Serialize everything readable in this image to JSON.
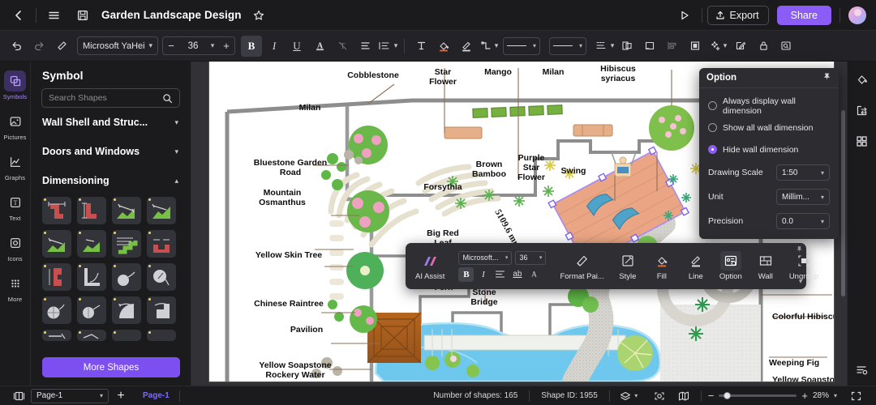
{
  "topbar": {
    "doc_title": "Garden Landscape Design",
    "export_label": "Export",
    "share_label": "Share",
    "icons": [
      "back-icon",
      "menu-icon",
      "save-icon",
      "star-icon",
      "present-icon",
      "upload-icon",
      "avatar"
    ]
  },
  "format_toolbar": {
    "font_family": "Microsoft YaHei",
    "font_size": "36",
    "decrease": "−",
    "increase": "+",
    "bold": "B",
    "italic": "I",
    "underline": "U",
    "font_color": "A",
    "strikethrough": "T"
  },
  "rail": {
    "items": [
      {
        "label": "Symbols",
        "icon": "symbols-icon",
        "selected": true
      },
      {
        "label": "Pictures",
        "icon": "pictures-icon",
        "selected": false
      },
      {
        "label": "Graphs",
        "icon": "graphs-icon",
        "selected": false
      },
      {
        "label": "Text",
        "icon": "text-icon",
        "selected": false
      },
      {
        "label": "Icons",
        "icon": "icons-icon",
        "selected": false
      },
      {
        "label": "More",
        "icon": "more-icon",
        "selected": false
      }
    ]
  },
  "symbol_panel": {
    "title": "Symbol",
    "search_placeholder": "Search Shapes",
    "search_value": "",
    "sections": [
      {
        "label": "Wall Shell and Struc...",
        "expanded": false
      },
      {
        "label": "Doors and Windows",
        "expanded": false
      },
      {
        "label": "Dimensioning",
        "expanded": true
      }
    ],
    "more_shapes_label": "More Shapes"
  },
  "option_panel": {
    "title": "Option",
    "pin_icon": "pin-icon",
    "radios": [
      {
        "label": "Always display wall dimension",
        "selected": false
      },
      {
        "label": "Show all wall dimension",
        "selected": false
      },
      {
        "label": "Hide wall dimension",
        "selected": true
      }
    ],
    "fields": [
      {
        "label": "Drawing Scale",
        "value": "1:50"
      },
      {
        "label": "Unit",
        "value": "Millim..."
      },
      {
        "label": "Precision",
        "value": "0.0"
      }
    ]
  },
  "mini_toolbar": {
    "ai_assist": "AI Assist",
    "font_family": "Microsoft...",
    "font_size": "36",
    "bold": "B",
    "italic": "I",
    "align": "align-icon",
    "ab": "ab",
    "font_color": "A",
    "items": [
      {
        "label": "Format Pai...",
        "icon": "format-painter-icon",
        "active": false
      },
      {
        "label": "Style",
        "icon": "style-icon",
        "active": false
      },
      {
        "label": "Fill",
        "icon": "fill-icon",
        "active": false
      },
      {
        "label": "Line",
        "icon": "line-icon",
        "active": false
      },
      {
        "label": "Option",
        "icon": "option-icon",
        "active": true
      },
      {
        "label": "Wall",
        "icon": "wall-icon",
        "active": false
      },
      {
        "label": "Ungroup",
        "icon": "ungroup-icon",
        "active": false
      }
    ]
  },
  "status_bar": {
    "page_select": "Page-1",
    "add_page": "+",
    "page_tab": "Page-1",
    "shapes_count": "Number of shapes: 165",
    "shape_id": "Shape ID: 1955",
    "zoom_value": "28%",
    "zoom_minus": "−",
    "zoom_plus": "+"
  },
  "canvas": {
    "selection_dimension": "5109.6 mm x 3468.4",
    "labels": [
      "Cobblestone",
      "Star Flower",
      "Mango",
      "Milan",
      "Hibiscus syriacus",
      "Milan",
      "Bluestone Garden Road",
      "Mountain Osmanthus",
      "Forsythia",
      "Brown Bamboo",
      "Purple Star Flower",
      "Swing",
      "Big Red Leaf",
      "Yellow Skin Tree",
      "Fern",
      "Stone Bridge",
      "Chinese Raintree",
      "Pavilion",
      "Colorful Hibiscus",
      "Weeping Fig",
      "Yellow Soapstone Rockery Water",
      "Yellow Soapstone"
    ]
  },
  "colors": {
    "accent": "#8b5cf6",
    "canvas_bg": "#313136",
    "panel_bg": "#1b1b1e",
    "toolbar_bg": "#232327"
  }
}
